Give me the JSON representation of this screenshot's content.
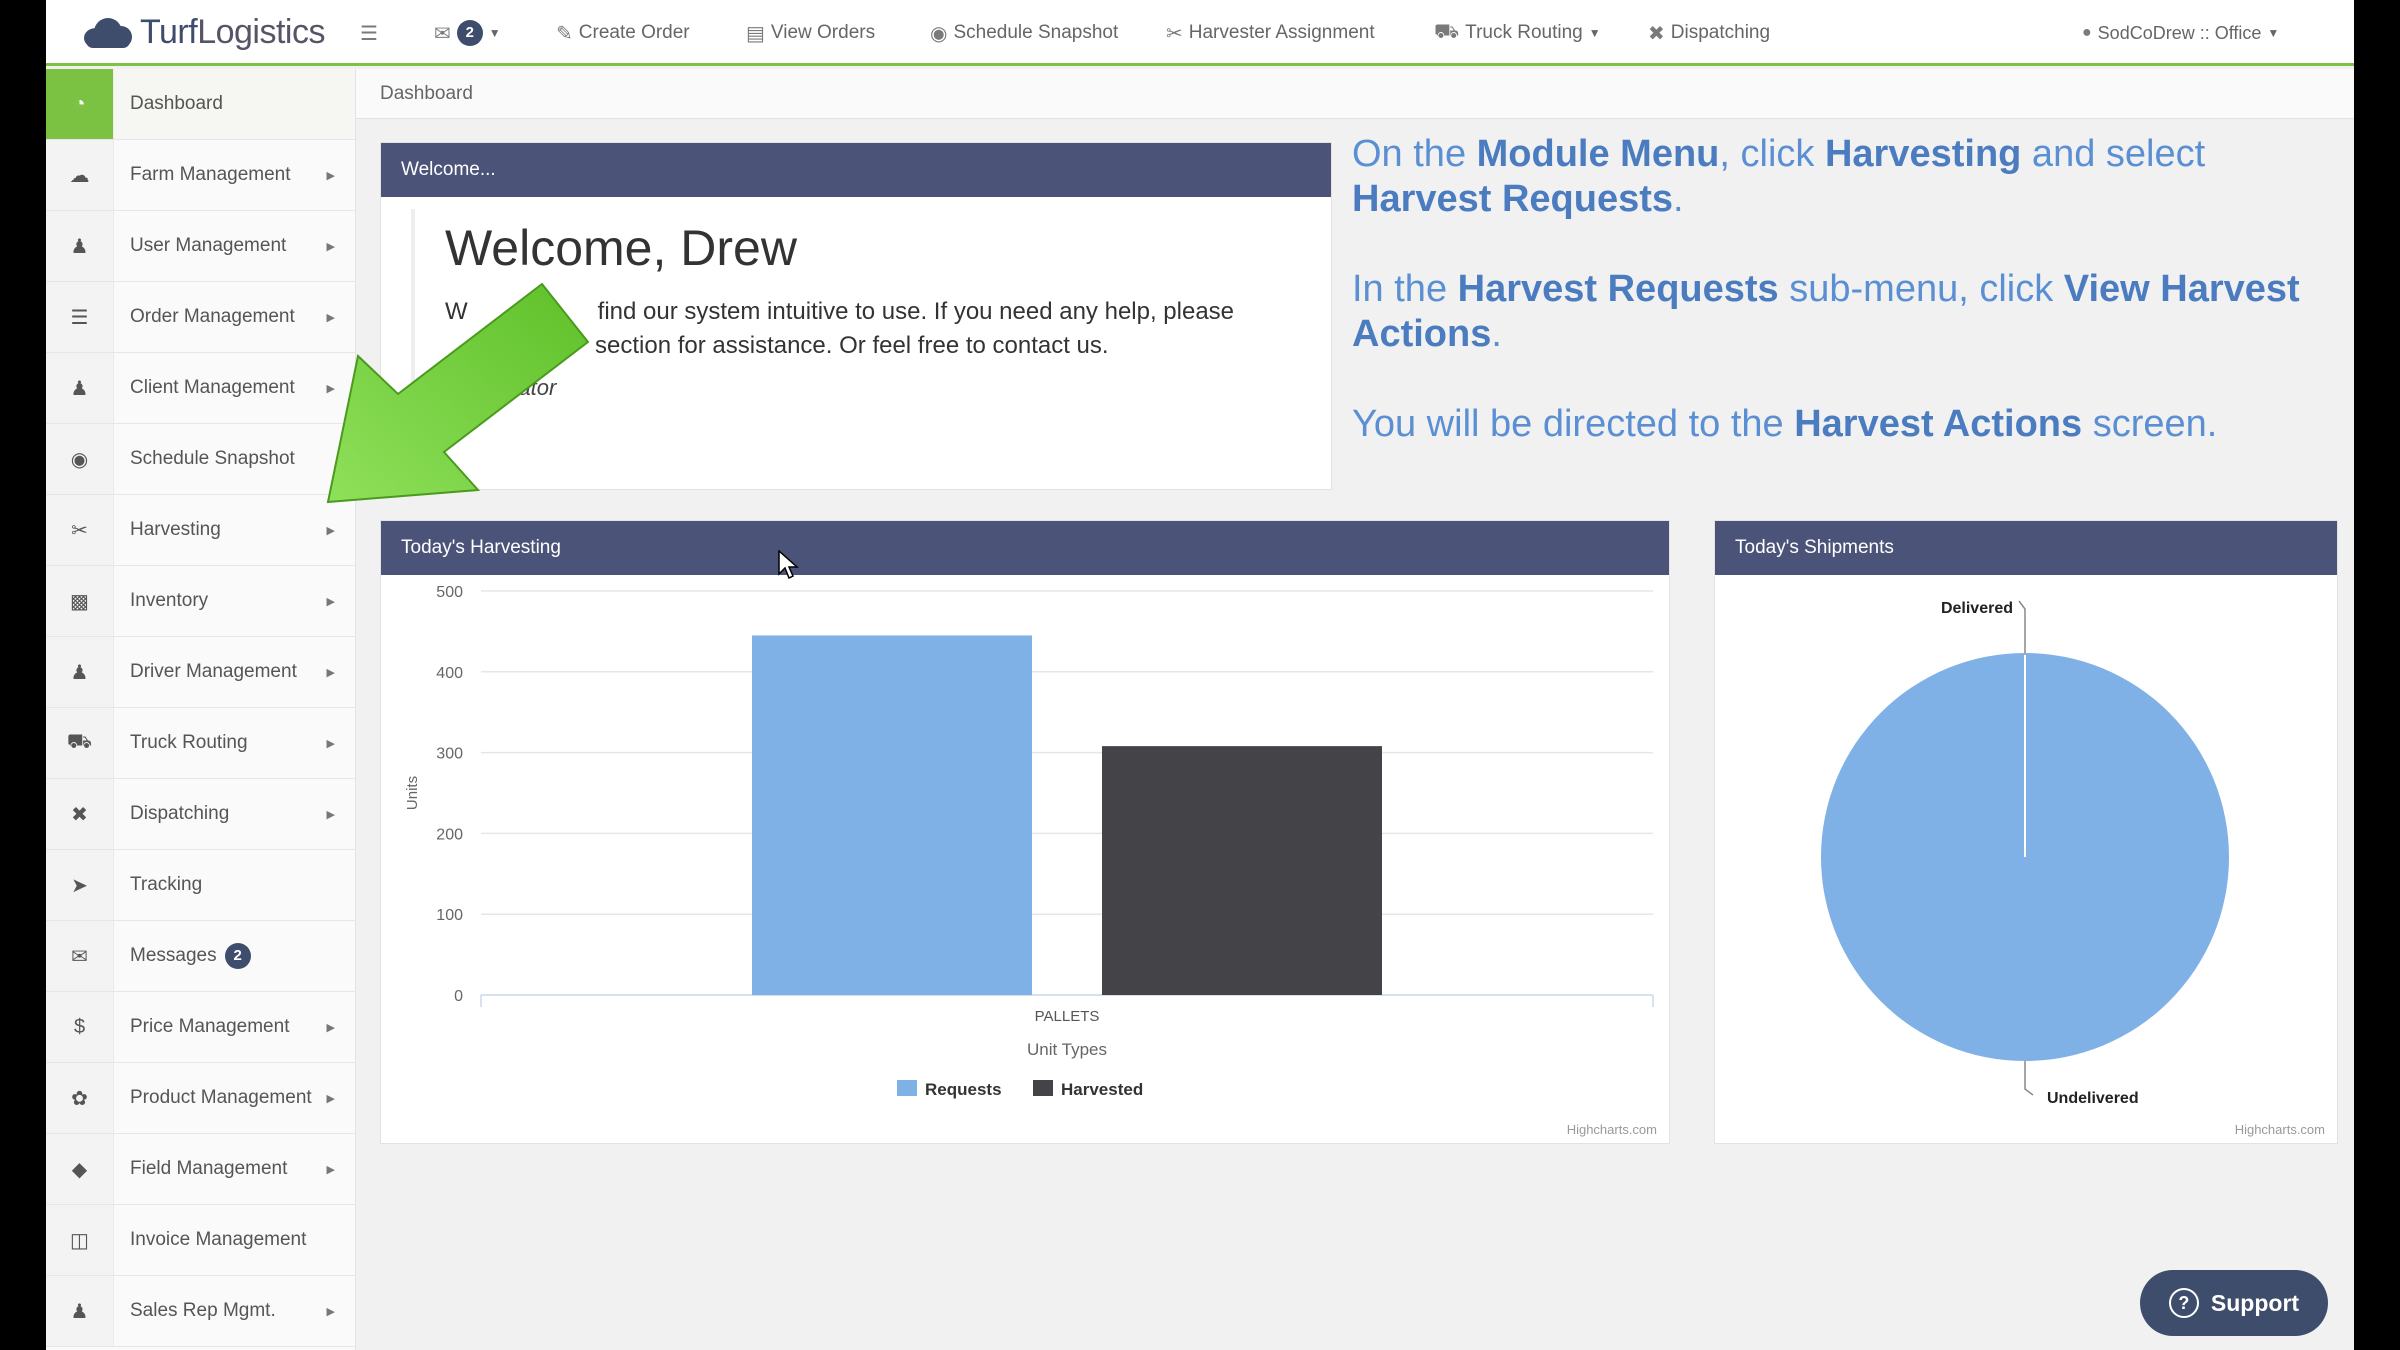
{
  "topbar": {
    "logo_text": "Turf",
    "logo_text2": "Logistics",
    "mail_count": "2",
    "nav": [
      {
        "label": "Create Order",
        "icon": "edit-icon"
      },
      {
        "label": "View Orders",
        "icon": "list-icon"
      },
      {
        "label": "Schedule Snapshot",
        "icon": "camera-icon"
      },
      {
        "label": "Harvester Assignment",
        "icon": "scissors-icon"
      },
      {
        "label": "Truck Routing",
        "icon": "truck-icon"
      },
      {
        "label": "Dispatching",
        "icon": "dispatch-icon"
      }
    ],
    "user": "SodCoDrew :: Office"
  },
  "sidebar": {
    "items": [
      {
        "label": "Dashboard"
      },
      {
        "label": "Farm Management"
      },
      {
        "label": "User Management"
      },
      {
        "label": "Order Management"
      },
      {
        "label": "Client Management"
      },
      {
        "label": "Schedule Snapshot"
      },
      {
        "label": "Harvesting"
      },
      {
        "label": "Inventory"
      },
      {
        "label": "Driver Management"
      },
      {
        "label": "Truck Routing"
      },
      {
        "label": "Dispatching"
      },
      {
        "label": "Tracking"
      },
      {
        "label": "Messages",
        "badge": "2"
      },
      {
        "label": "Price Management"
      },
      {
        "label": "Product Management"
      },
      {
        "label": "Field Management"
      },
      {
        "label": "Invoice Management"
      },
      {
        "label": "Sales Rep Mgmt."
      }
    ]
  },
  "breadcrumb": "Dashboard",
  "welcome": {
    "header": "Welcome...",
    "title": "Welcome, Drew",
    "line1_a": "W",
    "line1_b": "find our system intuitive to use. If you need any help, please",
    "line2": "section for assistance. Or feel free to contact us.",
    "signature": "trator"
  },
  "instructions": {
    "p1": [
      "On the ",
      "Module Menu",
      ", click ",
      "Harvesting",
      " and select ",
      "Harvest Requests",
      "."
    ],
    "p2": [
      "In the ",
      "Harvest Requests",
      " sub-menu, click ",
      "View Harvest Actions",
      "."
    ],
    "p3": [
      "You will be directed to the ",
      "Harvest Actions",
      " screen."
    ]
  },
  "harvest_panel": {
    "header": "Today's Harvesting",
    "credit": "Highcharts.com"
  },
  "shipments_panel": {
    "header": "Today's Shipments",
    "credit": "Highcharts.com"
  },
  "support_label": "Support",
  "colors": {
    "accent": "#7bc142",
    "panel_header": "#4b5478",
    "requests": "#7fb1e6",
    "harvested": "#434348",
    "instruction_text": "#5b8fd4"
  },
  "chart_data": [
    {
      "type": "bar",
      "categories": [
        "PALLETS"
      ],
      "series": [
        {
          "name": "Requests",
          "values": [
            445
          ]
        },
        {
          "name": "Harvested",
          "values": [
            308
          ]
        }
      ],
      "xlabel": "Unit Types",
      "ylabel": "Units",
      "ylim": [
        0,
        500
      ],
      "yticks": [
        0,
        100,
        200,
        300,
        400,
        500
      ],
      "legend": "bottom-center",
      "grid": true
    },
    {
      "type": "pie",
      "labels": [
        "Delivered",
        "Undelivered"
      ],
      "values": [
        0,
        100
      ],
      "legend": "none"
    }
  ]
}
